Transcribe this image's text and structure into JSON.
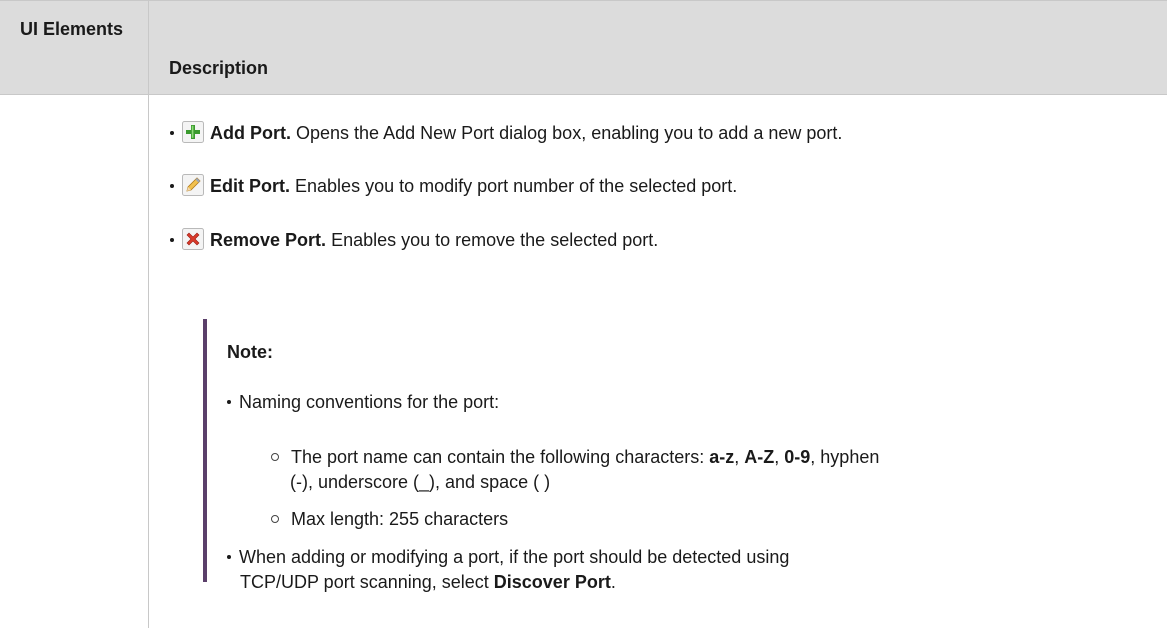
{
  "table": {
    "header_ui": "UI Elements",
    "header_description": "Description"
  },
  "buttons": [
    {
      "icon": "add-plus-icon",
      "label": "Add Port.",
      "text": "Opens the Add New Port dialog box, enabling you to add a new port."
    },
    {
      "icon": "edit-pencil-icon",
      "label": "Edit Port.",
      "text": "Enables you to modify port number of the selected port."
    },
    {
      "icon": "remove-x-icon",
      "label": "Remove Port.",
      "text": "Enables you to remove the selected port."
    }
  ],
  "note": {
    "title": "Note:",
    "item1": "Naming conventions for the port:",
    "sub1_prefix": "The port name can contain the following characters: ",
    "sub1_az": "a-z",
    "sub1_sep1": ", ",
    "sub1_AZ": "A-Z",
    "sub1_sep2": ", ",
    "sub1_09": "0-9",
    "sub1_suffix": ", hyphen",
    "sub1_line2": "(-), underscore (_), and space ( )",
    "sub2": "Max length: 255 characters",
    "item2_line1": "When adding or modifying a port, if the port should be detected using",
    "item2_line2_prefix": "TCP/UDP port scanning, select ",
    "item2_line2_bold": "Discover Port",
    "item2_line2_suffix": "."
  },
  "colors": {
    "header_bg": "#dcdcdc",
    "note_bar": "#5b3f6a",
    "add_green": "#3a9a2e",
    "remove_red": "#d93a2b"
  }
}
